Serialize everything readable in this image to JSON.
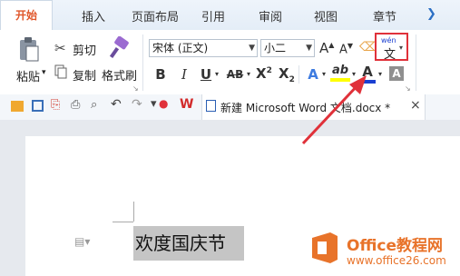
{
  "tabs": [
    {
      "label": "开始",
      "active": true
    },
    {
      "label": "插入"
    },
    {
      "label": "页面布局"
    },
    {
      "label": "引用"
    },
    {
      "label": "审阅"
    },
    {
      "label": "视图"
    },
    {
      "label": "章节"
    }
  ],
  "clipboard": {
    "paste_label": "粘贴",
    "cut_label": "剪切",
    "copy_label": "复制",
    "format_painter_label": "格式刷"
  },
  "font": {
    "family_value": "宋体 (正文)",
    "size_value": "小二",
    "grow_label": "A",
    "shrink_label": "A",
    "bold_label": "B",
    "italic_label": "I",
    "underline_label": "U",
    "strike_label": "AB",
    "superscript_label": "X",
    "subscript_label": "X",
    "effect_label": "A",
    "highlight_label": "ab",
    "fontcolor_label": "A",
    "charshade_label": "A",
    "phonetic_top": "wén",
    "phonetic_bottom": "文",
    "highlight_color": "#ffff00",
    "fontcolor_color": "#1a3fd1"
  },
  "document": {
    "tab_title": "新建 Microsoft Word 文档.docx *",
    "close_label": "×",
    "body_text": "欢度国庆节"
  },
  "watermark": {
    "title": "Office教程网",
    "url": "www.office26.com"
  },
  "colors": {
    "accent": "#e0562a",
    "annotation_red": "#e0313a"
  }
}
